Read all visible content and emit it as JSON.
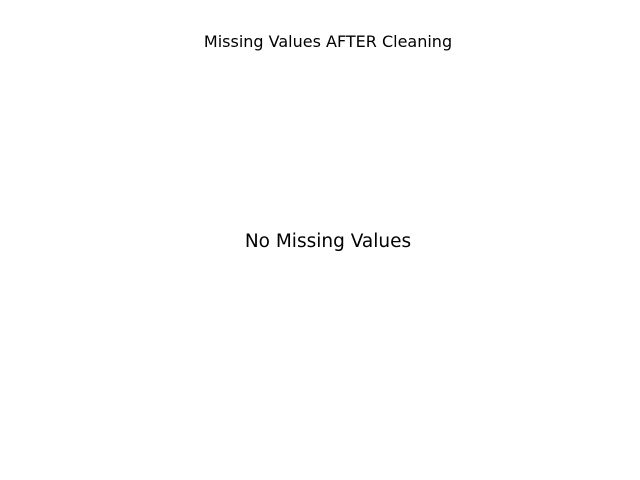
{
  "chart_data": {
    "type": "bar",
    "title": "Missing Values AFTER Cleaning",
    "categories": [],
    "values": [],
    "annotations": [
      "No Missing Values"
    ],
    "grid": false,
    "axes_visible": false
  }
}
